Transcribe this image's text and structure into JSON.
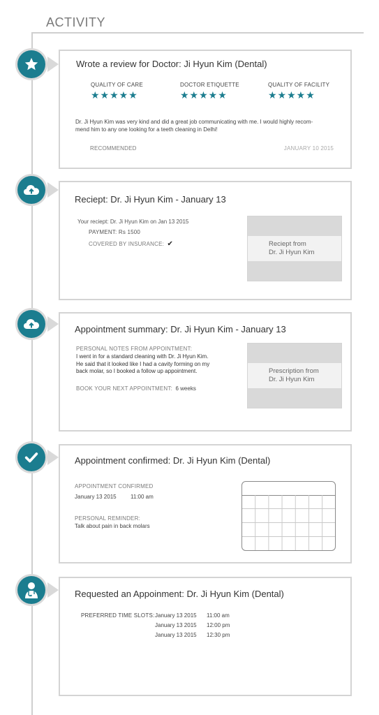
{
  "page": {
    "title": "ACTIVITY"
  },
  "theme": {
    "accent": "#1b7d8f",
    "border": "#d4d4d4",
    "timeline": "#cfcfcf"
  },
  "review": {
    "icon": "star-icon",
    "title": "Wrote a review for Doctor: Ji Hyun Kim (Dental)",
    "ratings": [
      {
        "label": "QUALITY OF CARE",
        "stars": 5
      },
      {
        "label": "DOCTOR ETIQUETTE",
        "stars": 5
      },
      {
        "label": "QUALITY OF FACILITY",
        "stars": 5
      }
    ],
    "body_line1": "Dr. Ji Hyun Kim was very kind and did a great job communicating with me. I would highly recom-",
    "body_line2": "mend him to any one looking for a teeth cleaning in Delhi!",
    "status": "RECOMMENDED",
    "date": "JANUARY 10 2015"
  },
  "receipt": {
    "icon": "cloud-upload-icon",
    "title": "Reciept: Dr. Ji Hyun Kim - January 13",
    "line": "Your reciept: Dr. Ji Hyun Kim on Jan 13 2015",
    "payment": "PAYMENT: Rs 1500",
    "insurance": "COVERED BY INSURANCE:",
    "insurance_mark": "✔",
    "thumb_line1": "Reciept from",
    "thumb_line2": "Dr. Ji Hyun Kim"
  },
  "summary": {
    "icon": "cloud-upload-icon",
    "title": "Appointment summary: Dr. Ji Hyun Kim - January 13",
    "notes_label": "PERSONAL NOTES FROM APPOINTMENT:",
    "notes_line1": "I went in for a standard cleaning with Dr. Ji Hyun Kim.",
    "notes_line2": "He said that it looked like I had a cavity forming on my",
    "notes_line3": "back molar, so I booked a follow up appointment.",
    "next_label": "BOOK YOUR NEXT APPOINTMENT:",
    "next_value": "6 weeks",
    "thumb_line1": "Prescription from",
    "thumb_line2": "Dr. Ji Hyun Kim"
  },
  "confirmed": {
    "icon": "checkmark-icon",
    "title": "Appointment confirmed: Dr. Ji Hyun Kim (Dental)",
    "status_label": "APPOINTMENT CONFIRMED",
    "date": "January 13 2015",
    "time": "11:00 am",
    "reminder_label": "PERSONAL REMINDER:",
    "reminder_text": "Talk about pain in back molars",
    "calendar_icon": "calendar-icon"
  },
  "requested": {
    "icon": "doctor-icon",
    "title": "Requested an Appoinment: Dr. Ji Hyun Kim (Dental)",
    "slots_label": "PREFERRED TIME SLOTS:",
    "slots": [
      {
        "date": "January 13 2015",
        "time": "11:00 am"
      },
      {
        "date": "January 13 2015",
        "time": "12:00 pm"
      },
      {
        "date": "January 13 2015",
        "time": "12:30 pm"
      }
    ]
  }
}
